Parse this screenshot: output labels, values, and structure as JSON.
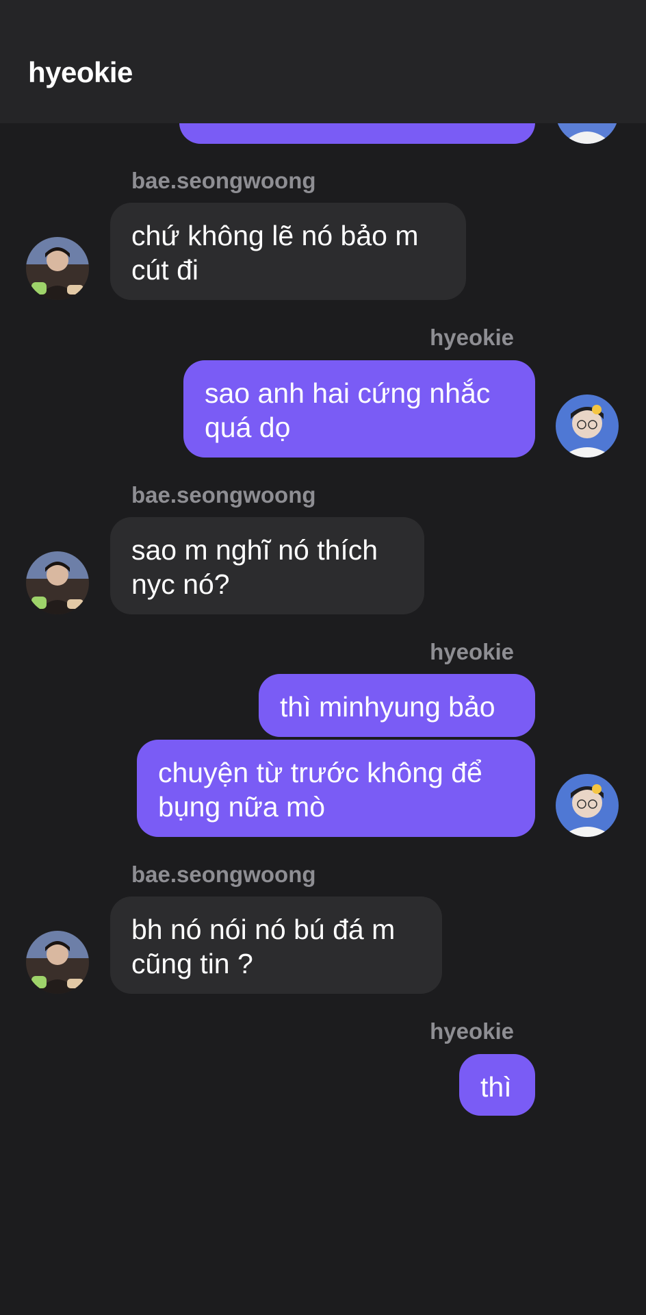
{
  "header": {
    "title": "hyeokie"
  },
  "messages": [
    {
      "sender": "bae.seongwoong",
      "text": "chứ không lẽ nó bảo m\ncút đi"
    },
    {
      "sender": "hyeokie",
      "text": "sao anh hai cứng nhắc\nquá dọ"
    },
    {
      "sender": "bae.seongwoong",
      "text": "sao m nghĩ nó thích\nnyc nó?"
    },
    {
      "sender": "hyeokie",
      "text": "thì minhyung bảo"
    },
    {
      "text": "chuyện từ trước không để\nbụng nữa mò"
    },
    {
      "sender": "bae.seongwoong",
      "text": "bh nó nói nó bú đá m\ncũng tin ?"
    },
    {
      "sender": "hyeokie",
      "text": "thì"
    }
  ],
  "colors": {
    "background": "#1c1c1e",
    "header": "#252527",
    "incoming_bubble": "#2c2c2e",
    "outgoing_bubble": "#7a5cf5",
    "sender_label": "#8e8e93"
  },
  "icons": {
    "other_avatar": "avatar-photo",
    "self_avatar": "avatar-photo"
  }
}
